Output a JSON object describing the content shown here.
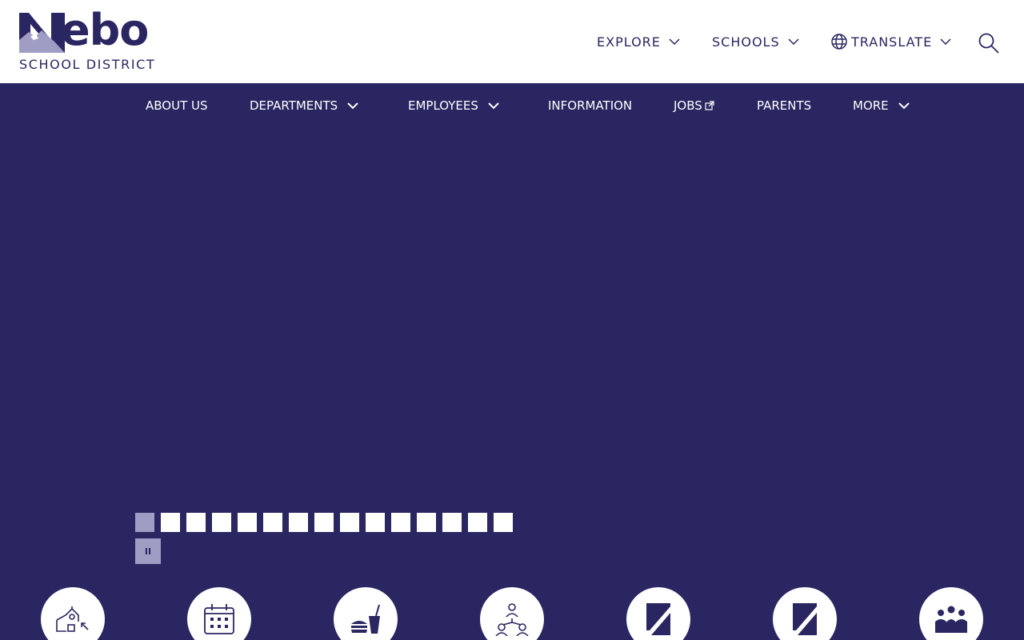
{
  "logo": {
    "word": "ebo",
    "subtitle": "SCHOOL DISTRICT"
  },
  "utility": {
    "explore": "EXPLORE",
    "schools": "SCHOOLS",
    "translate": "TRANSLATE"
  },
  "nav": {
    "items": [
      {
        "label": "ABOUT US"
      },
      {
        "label": "DEPARTMENTS"
      },
      {
        "label": "EMPLOYEES"
      },
      {
        "label": "INFORMATION"
      },
      {
        "label": "JOBS"
      },
      {
        "label": "PARENTS"
      },
      {
        "label": "MORE"
      }
    ]
  },
  "slider": {
    "total_slides": 15,
    "active_slide": 1,
    "pause_label": "II"
  },
  "quicklinks": {
    "icons": [
      "school-icon",
      "calendar-icon",
      "food-icon",
      "org-chart-icon",
      "app-logo-icon",
      "app-logo-icon",
      "community-icon"
    ]
  },
  "colors": {
    "brand": "#2a2661",
    "accent": "#9f9dc4",
    "white": "#ffffff"
  }
}
